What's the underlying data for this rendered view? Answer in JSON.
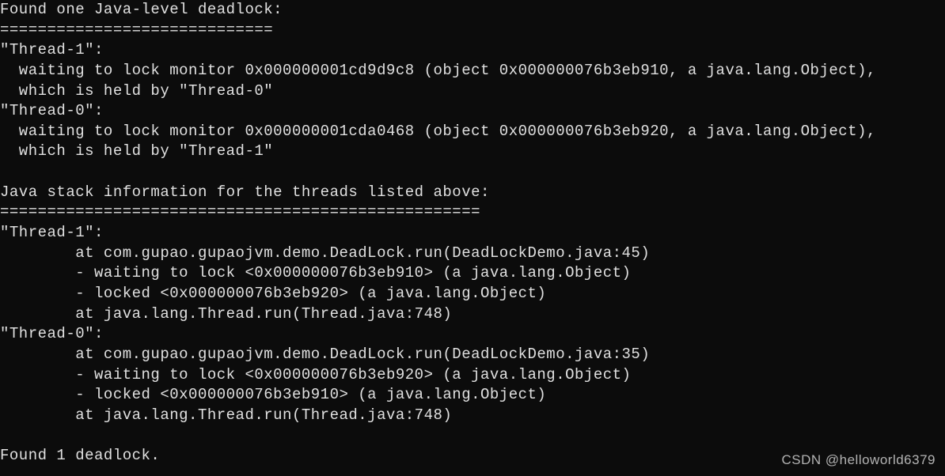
{
  "terminal": {
    "lines": [
      "Found one Java-level deadlock:",
      "=============================",
      "\"Thread-1\":",
      "  waiting to lock monitor 0x000000001cd9d9c8 (object 0x000000076b3eb910, a java.lang.Object),",
      "  which is held by \"Thread-0\"",
      "\"Thread-0\":",
      "  waiting to lock monitor 0x000000001cda0468 (object 0x000000076b3eb920, a java.lang.Object),",
      "  which is held by \"Thread-1\"",
      "",
      "Java stack information for the threads listed above:",
      "===================================================",
      "\"Thread-1\":",
      "        at com.gupao.gupaojvm.demo.DeadLock.run(DeadLockDemo.java:45)",
      "        - waiting to lock <0x000000076b3eb910> (a java.lang.Object)",
      "        - locked <0x000000076b3eb920> (a java.lang.Object)",
      "        at java.lang.Thread.run(Thread.java:748)",
      "\"Thread-0\":",
      "        at com.gupao.gupaojvm.demo.DeadLock.run(DeadLockDemo.java:35)",
      "        - waiting to lock <0x000000076b3eb920> (a java.lang.Object)",
      "        - locked <0x000000076b3eb910> (a java.lang.Object)",
      "        at java.lang.Thread.run(Thread.java:748)",
      "",
      "Found 1 deadlock."
    ]
  },
  "watermark": "CSDN @helloworld6379"
}
